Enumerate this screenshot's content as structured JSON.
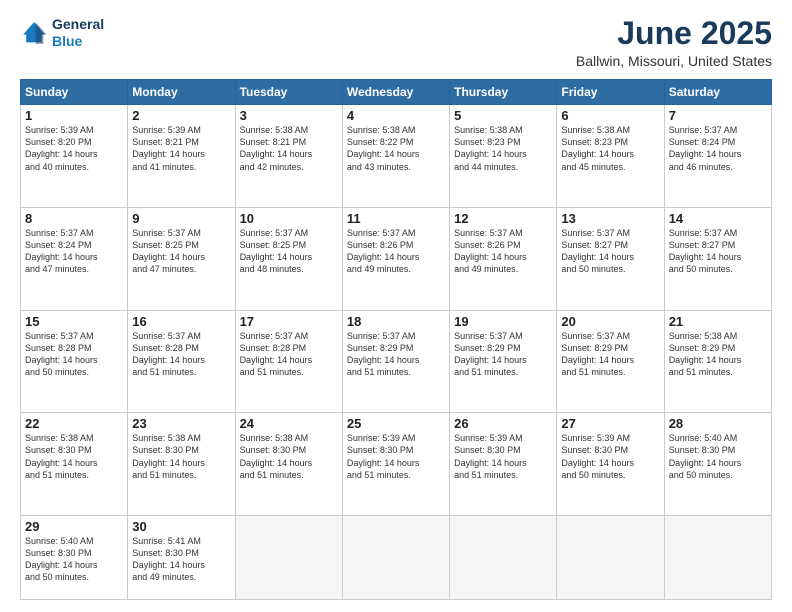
{
  "header": {
    "logo_line1": "General",
    "logo_line2": "Blue",
    "month": "June 2025",
    "location": "Ballwin, Missouri, United States"
  },
  "weekdays": [
    "Sunday",
    "Monday",
    "Tuesday",
    "Wednesday",
    "Thursday",
    "Friday",
    "Saturday"
  ],
  "weeks": [
    [
      {
        "day": "1",
        "text": "Sunrise: 5:39 AM\nSunset: 8:20 PM\nDaylight: 14 hours\nand 40 minutes."
      },
      {
        "day": "2",
        "text": "Sunrise: 5:39 AM\nSunset: 8:21 PM\nDaylight: 14 hours\nand 41 minutes."
      },
      {
        "day": "3",
        "text": "Sunrise: 5:38 AM\nSunset: 8:21 PM\nDaylight: 14 hours\nand 42 minutes."
      },
      {
        "day": "4",
        "text": "Sunrise: 5:38 AM\nSunset: 8:22 PM\nDaylight: 14 hours\nand 43 minutes."
      },
      {
        "day": "5",
        "text": "Sunrise: 5:38 AM\nSunset: 8:23 PM\nDaylight: 14 hours\nand 44 minutes."
      },
      {
        "day": "6",
        "text": "Sunrise: 5:38 AM\nSunset: 8:23 PM\nDaylight: 14 hours\nand 45 minutes."
      },
      {
        "day": "7",
        "text": "Sunrise: 5:37 AM\nSunset: 8:24 PM\nDaylight: 14 hours\nand 46 minutes."
      }
    ],
    [
      {
        "day": "8",
        "text": "Sunrise: 5:37 AM\nSunset: 8:24 PM\nDaylight: 14 hours\nand 47 minutes."
      },
      {
        "day": "9",
        "text": "Sunrise: 5:37 AM\nSunset: 8:25 PM\nDaylight: 14 hours\nand 47 minutes."
      },
      {
        "day": "10",
        "text": "Sunrise: 5:37 AM\nSunset: 8:25 PM\nDaylight: 14 hours\nand 48 minutes."
      },
      {
        "day": "11",
        "text": "Sunrise: 5:37 AM\nSunset: 8:26 PM\nDaylight: 14 hours\nand 49 minutes."
      },
      {
        "day": "12",
        "text": "Sunrise: 5:37 AM\nSunset: 8:26 PM\nDaylight: 14 hours\nand 49 minutes."
      },
      {
        "day": "13",
        "text": "Sunrise: 5:37 AM\nSunset: 8:27 PM\nDaylight: 14 hours\nand 50 minutes."
      },
      {
        "day": "14",
        "text": "Sunrise: 5:37 AM\nSunset: 8:27 PM\nDaylight: 14 hours\nand 50 minutes."
      }
    ],
    [
      {
        "day": "15",
        "text": "Sunrise: 5:37 AM\nSunset: 8:28 PM\nDaylight: 14 hours\nand 50 minutes."
      },
      {
        "day": "16",
        "text": "Sunrise: 5:37 AM\nSunset: 8:28 PM\nDaylight: 14 hours\nand 51 minutes."
      },
      {
        "day": "17",
        "text": "Sunrise: 5:37 AM\nSunset: 8:28 PM\nDaylight: 14 hours\nand 51 minutes."
      },
      {
        "day": "18",
        "text": "Sunrise: 5:37 AM\nSunset: 8:29 PM\nDaylight: 14 hours\nand 51 minutes."
      },
      {
        "day": "19",
        "text": "Sunrise: 5:37 AM\nSunset: 8:29 PM\nDaylight: 14 hours\nand 51 minutes."
      },
      {
        "day": "20",
        "text": "Sunrise: 5:37 AM\nSunset: 8:29 PM\nDaylight: 14 hours\nand 51 minutes."
      },
      {
        "day": "21",
        "text": "Sunrise: 5:38 AM\nSunset: 8:29 PM\nDaylight: 14 hours\nand 51 minutes."
      }
    ],
    [
      {
        "day": "22",
        "text": "Sunrise: 5:38 AM\nSunset: 8:30 PM\nDaylight: 14 hours\nand 51 minutes."
      },
      {
        "day": "23",
        "text": "Sunrise: 5:38 AM\nSunset: 8:30 PM\nDaylight: 14 hours\nand 51 minutes."
      },
      {
        "day": "24",
        "text": "Sunrise: 5:38 AM\nSunset: 8:30 PM\nDaylight: 14 hours\nand 51 minutes."
      },
      {
        "day": "25",
        "text": "Sunrise: 5:39 AM\nSunset: 8:30 PM\nDaylight: 14 hours\nand 51 minutes."
      },
      {
        "day": "26",
        "text": "Sunrise: 5:39 AM\nSunset: 8:30 PM\nDaylight: 14 hours\nand 51 minutes."
      },
      {
        "day": "27",
        "text": "Sunrise: 5:39 AM\nSunset: 8:30 PM\nDaylight: 14 hours\nand 50 minutes."
      },
      {
        "day": "28",
        "text": "Sunrise: 5:40 AM\nSunset: 8:30 PM\nDaylight: 14 hours\nand 50 minutes."
      }
    ],
    [
      {
        "day": "29",
        "text": "Sunrise: 5:40 AM\nSunset: 8:30 PM\nDaylight: 14 hours\nand 50 minutes."
      },
      {
        "day": "30",
        "text": "Sunrise: 5:41 AM\nSunset: 8:30 PM\nDaylight: 14 hours\nand 49 minutes."
      },
      {
        "day": "",
        "text": ""
      },
      {
        "day": "",
        "text": ""
      },
      {
        "day": "",
        "text": ""
      },
      {
        "day": "",
        "text": ""
      },
      {
        "day": "",
        "text": ""
      }
    ]
  ]
}
